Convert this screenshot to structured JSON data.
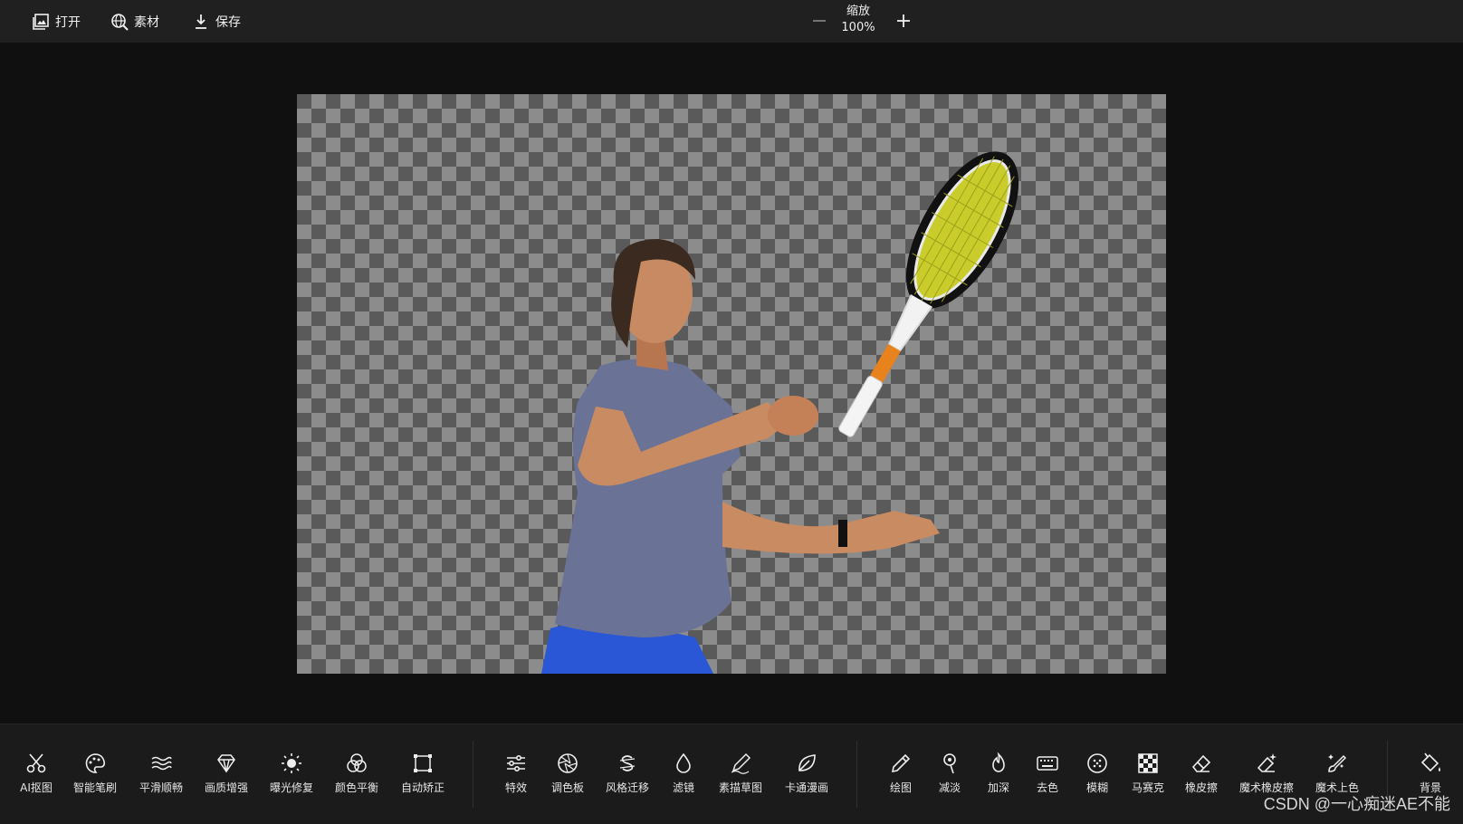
{
  "topbar": {
    "open_label": "打开",
    "material_label": "素材",
    "save_label": "保存",
    "zoom_title": "缩放",
    "zoom_value": "100%"
  },
  "toolbar": {
    "group1": [
      {
        "label": "AI抠图",
        "icon": "scissors-icon"
      },
      {
        "label": "智能笔刷",
        "icon": "palette-icon"
      },
      {
        "label": "平滑顺畅",
        "icon": "waves-icon"
      },
      {
        "label": "画质增强",
        "icon": "diamond-icon"
      },
      {
        "label": "曝光修复",
        "icon": "sun-icon"
      },
      {
        "label": "颜色平衡",
        "icon": "color-circles-icon"
      },
      {
        "label": "自动矫正",
        "icon": "crop-square-icon"
      }
    ],
    "group2": [
      {
        "label": "特效",
        "icon": "sliders-icon"
      },
      {
        "label": "调色板",
        "icon": "aperture-icon"
      },
      {
        "label": "风格迁移",
        "icon": "dollar-style-icon"
      },
      {
        "label": "滤镜",
        "icon": "droplet-icon"
      },
      {
        "label": "素描草图",
        "icon": "sketch-pencil-icon"
      },
      {
        "label": "卡通漫画",
        "icon": "leaf-icon"
      }
    ],
    "group3": [
      {
        "label": "绘图",
        "icon": "pencil-icon"
      },
      {
        "label": "减淡",
        "icon": "dodge-icon"
      },
      {
        "label": "加深",
        "icon": "flame-icon"
      },
      {
        "label": "去色",
        "icon": "keyboard-icon"
      },
      {
        "label": "模糊",
        "icon": "blur-circle-icon"
      },
      {
        "label": "马赛克",
        "icon": "mosaic-icon"
      },
      {
        "label": "橡皮擦",
        "icon": "eraser-icon"
      },
      {
        "label": "魔术橡皮擦",
        "icon": "magic-eraser-icon"
      },
      {
        "label": "魔术上色",
        "icon": "magic-brush-icon"
      }
    ],
    "background_label": "背景",
    "background_icon": "paint-bucket-icon"
  },
  "watermark": "CSDN @一心痴迷AE不能"
}
